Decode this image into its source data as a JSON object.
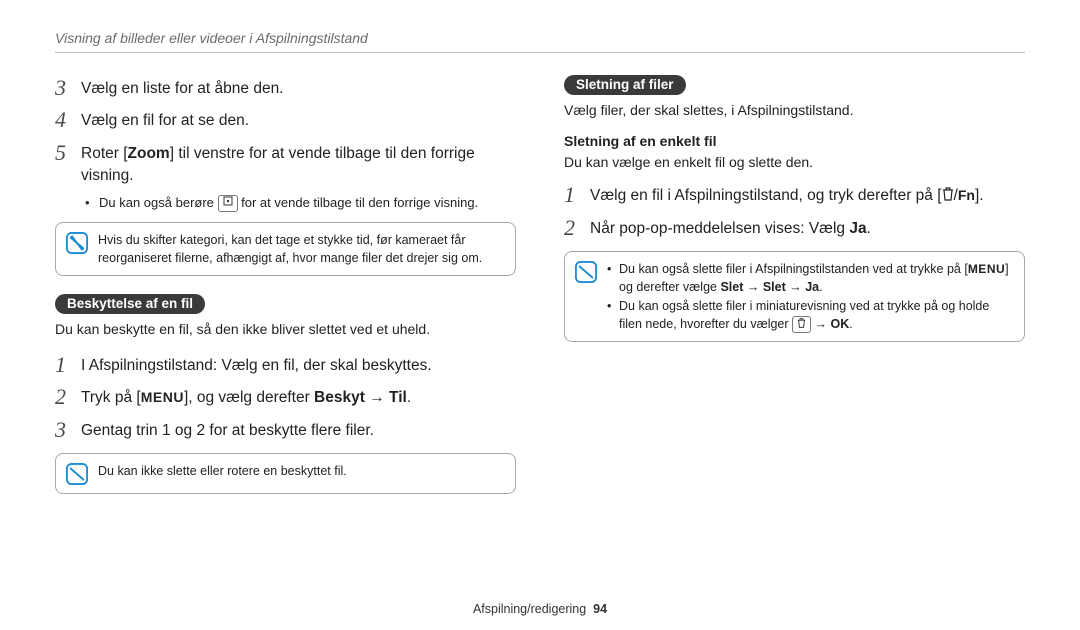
{
  "header": {
    "title": "Visning af billeder eller videoer i Afspilningstilstand"
  },
  "left": {
    "steps1": [
      {
        "num": "3",
        "text": "Vælg en liste for at åbne den."
      },
      {
        "num": "4",
        "text": "Vælg en fil for at se den."
      }
    ],
    "step5": {
      "num": "5",
      "pre": "Roter [",
      "zoom": "Zoom",
      "post": "] til venstre for at vende tilbage til den forrige visning."
    },
    "bullet1": {
      "pre": "Du kan også berøre ",
      "post": " for at vende tilbage til den forrige visning."
    },
    "note1": "Hvis du skifter kategori, kan det tage et stykke tid, før kameraet får reorganiseret filerne, afhængigt af, hvor mange filer det drejer sig om.",
    "pill": "Beskyttelse af en fil",
    "pill_sub": "Du kan beskytte en fil, så den ikke bliver slettet ved et uheld.",
    "steps2": {
      "s1": {
        "num": "1",
        "text": "I Afspilningstilstand: Vælg en fil, der skal beskyttes."
      },
      "s2": {
        "num": "2",
        "pre": "Tryk på [",
        "mid": "], og vælg derefter ",
        "b1": "Beskyt",
        "arr": " → ",
        "b2": "Til",
        "end": "."
      },
      "s3": {
        "num": "3",
        "text": "Gentag trin 1 og 2 for at beskytte flere filer."
      }
    },
    "note2": "Du kan ikke slette eller rotere en beskyttet fil."
  },
  "right": {
    "pill": "Sletning af filer",
    "pill_sub": "Vælg filer, der skal slettes, i Afspilningstilstand.",
    "sub_head": "Sletning af en enkelt fil",
    "sub_text": "Du kan vælge en enkelt fil og slette den.",
    "steps": {
      "s1": {
        "num": "1",
        "pre": "Vælg en fil i Afspilningstilstand, og tryk derefter på [",
        "end": "]."
      },
      "s2": {
        "num": "2",
        "pre": "Når pop-op-meddelelsen vises: Vælg ",
        "b": "Ja",
        "end": "."
      }
    },
    "note": {
      "l1": {
        "pre": "Du kan også slette filer i Afspilningstilstanden ved at trykke på [",
        "mid": "] og derefter vælge ",
        "b1": "Slet",
        "a1": " → ",
        "b2": "Slet",
        "a2": " → ",
        "b3": "Ja",
        "end": "."
      },
      "l2": {
        "pre": "Du kan også slette filer i miniaturevisning ved at trykke på og holde filen nede, hvorefter du vælger ",
        "a": " → ",
        "b": "OK",
        "end": "."
      }
    }
  },
  "footer": {
    "section": "Afspilning/redigering",
    "page": "94"
  }
}
